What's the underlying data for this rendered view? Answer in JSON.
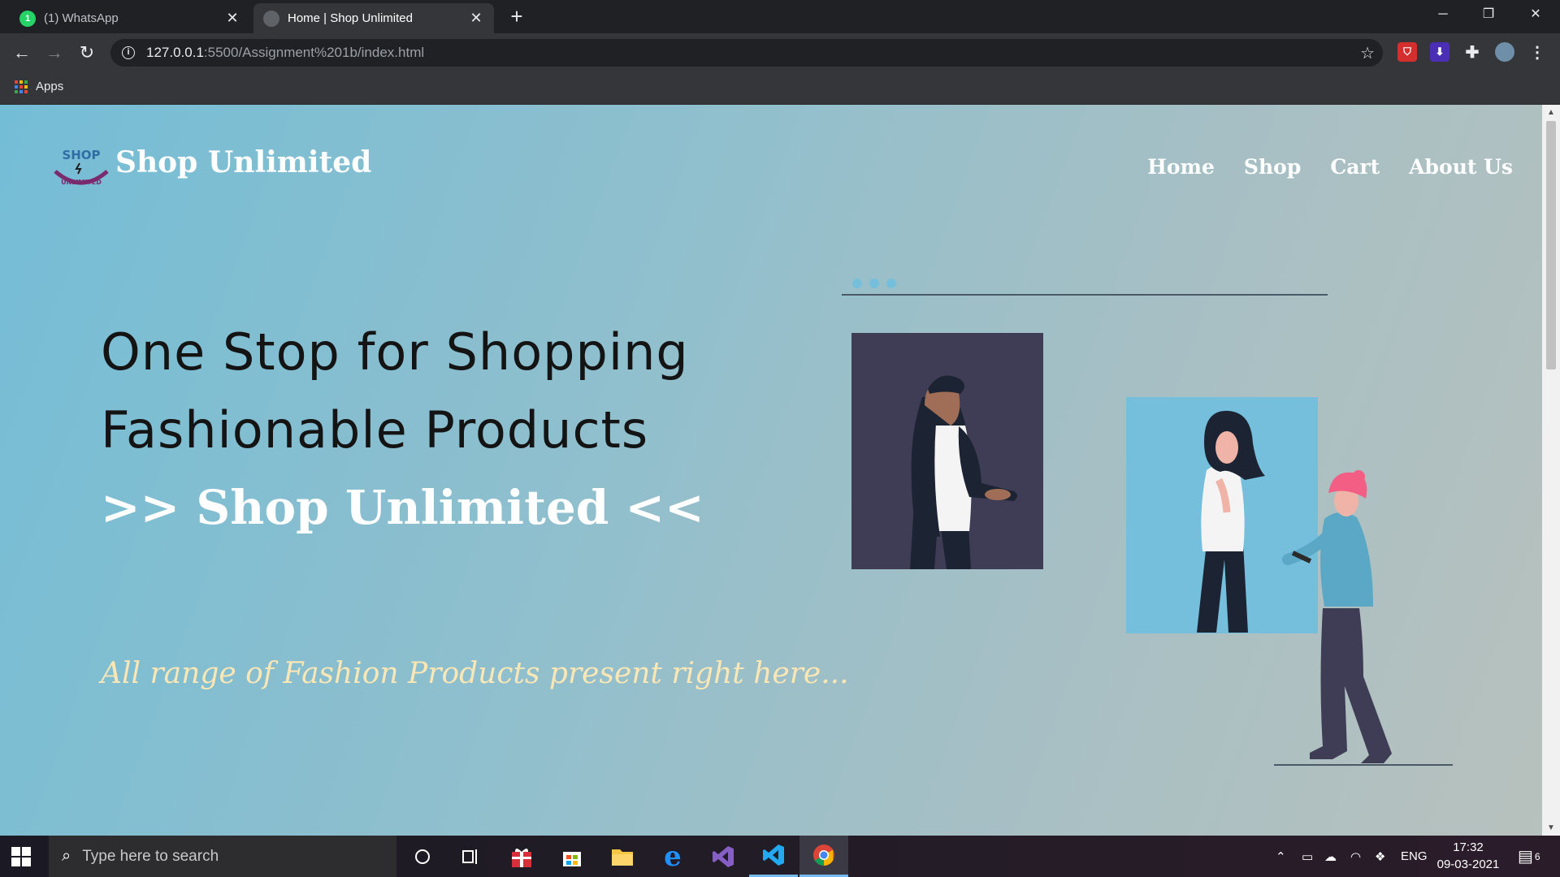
{
  "browser": {
    "tabs": [
      {
        "title": "(1) WhatsApp",
        "favicon": "whatsapp-icon"
      },
      {
        "title": "Home | Shop Unlimited",
        "favicon": "globe-icon"
      }
    ],
    "url_host": "127.0.0.1",
    "url_path": ":5500/Assignment%201b/index.html",
    "bookmarks": {
      "apps_label": "Apps"
    }
  },
  "site": {
    "logo_text_top": "SHOP",
    "logo_text_bottom": "UNLIMITED",
    "brand": "Shop Unlimited",
    "nav": [
      "Home",
      "Shop",
      "Cart",
      "About Us"
    ],
    "hero_line1": "One Stop for Shopping",
    "hero_line2": "Fashionable Products",
    "hero_line3": ">> Shop Unlimited <<",
    "tagline": "All range of Fashion Products present right here..."
  },
  "taskbar": {
    "search_placeholder": "Type here to search",
    "language": "ENG",
    "time": "17:32",
    "date": "09-03-2021",
    "notifications": "6"
  },
  "colors": {
    "accent_blue": "#76bfdc",
    "frame_dark": "#3f3d56",
    "tagline": "#fbe7b5",
    "hair_pink": "#f25e84"
  }
}
